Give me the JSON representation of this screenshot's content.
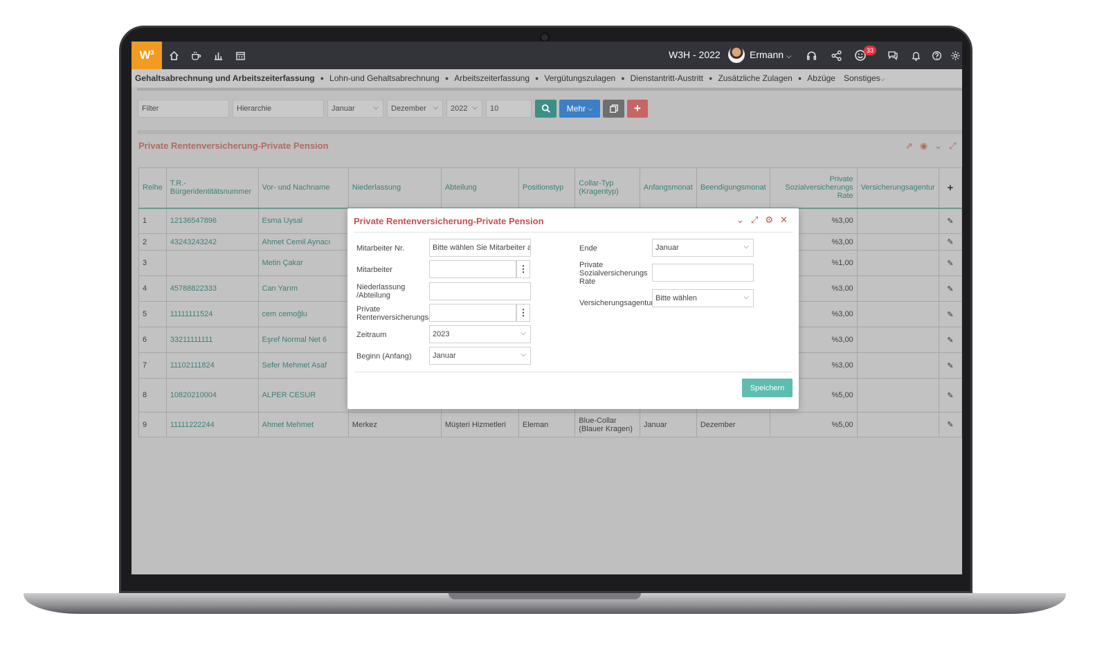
{
  "topbar": {
    "logo": "W",
    "logo_sup": "3",
    "title": "W3H - 2022",
    "user_name": "Ermann",
    "notification_count": "33"
  },
  "menu": {
    "items": [
      "Gehaltsabrechnung und Arbeitszeiterfassung",
      "Lohn-und Gehaltsabrechnung",
      "Arbeitszeiterfassung",
      "Vergütungszulagen",
      "Dienstantritt-Austritt",
      "Zusätzliche Zulagen",
      "Abzüge",
      "Sonstiges"
    ]
  },
  "filters": {
    "filter_placeholder": "Filter",
    "hierarchy_placeholder": "Hierarchie",
    "start_month": "Januar",
    "end_month": "Dezember",
    "year": "2022",
    "count": "10",
    "more_label": "Mehr"
  },
  "panel": {
    "title": "Private Rentenversicherung-Private Pension"
  },
  "table": {
    "headers": [
      "Reihe",
      "T.R.-Bürgeridentitätsnummer",
      "Vor- und Nachname",
      "Niederlassung",
      "Abteilung",
      "Positionstyp",
      "Collar-Typ (Kragentyp)",
      "Anfangsmonat",
      "Beendigungsmonat",
      "Private Sozialversicherungs Rate",
      "Versicherungsagentur"
    ],
    "rows": [
      {
        "n": "1",
        "id": "12136547896",
        "name": "Esma Uysal",
        "branch": "",
        "dept": "",
        "pos": "",
        "collar": "",
        "start": "",
        "end": "",
        "rate": "%3,00",
        "agency": ""
      },
      {
        "n": "2",
        "id": "43243243242",
        "name": "Ahmet Cemil Aynacı",
        "branch": "",
        "dept": "",
        "pos": "",
        "collar": "",
        "start": "",
        "end": "",
        "rate": "%3,00",
        "agency": ""
      },
      {
        "n": "3",
        "id": "",
        "name": "Metin Çakar",
        "branch": "",
        "dept": "",
        "pos": "",
        "collar": "",
        "start": "",
        "end": "",
        "rate": "%1,00",
        "agency": ""
      },
      {
        "n": "4",
        "id": "45788822333",
        "name": "Can Yarım",
        "branch": "",
        "dept": "",
        "pos": "",
        "collar": "",
        "start": "",
        "end": "",
        "rate": "%3,00",
        "agency": ""
      },
      {
        "n": "5",
        "id": "11111111524",
        "name": "cem cemoğlu",
        "branch": "",
        "dept": "",
        "pos": "",
        "collar": "",
        "start": "",
        "end": "",
        "rate": "%3,00",
        "agency": ""
      },
      {
        "n": "6",
        "id": "33211111111",
        "name": "Eşref Normal Net 6",
        "branch": "",
        "dept": "",
        "pos": "",
        "collar": "",
        "start": "",
        "end": "",
        "rate": "%3,00",
        "agency": ""
      },
      {
        "n": "7",
        "id": "11102111824",
        "name": "Sefer Mehmet Asaf",
        "branch": "",
        "dept": "",
        "pos": "",
        "collar": "",
        "start": "",
        "end": "",
        "rate": "%3,00",
        "agency": ""
      },
      {
        "n": "8",
        "id": "10820210004",
        "name": "ALPER CESUR",
        "branch": "",
        "dept": "",
        "pos": "",
        "collar": "",
        "start": "",
        "end": "",
        "rate": "%5,00",
        "agency": ""
      },
      {
        "n": "9",
        "id": "11111222244",
        "name": "Ahmet Mehmet",
        "branch": "Merkez",
        "dept": "Müşteri Hizmetleri",
        "pos": "Eleman",
        "collar": "Blue-Collar (Blauer Kragen)",
        "start": "Januar",
        "end": "Dezember",
        "rate": "%5,00",
        "agency": ""
      }
    ]
  },
  "modal": {
    "title": "Private Rentenversicherung-Private Pension",
    "labels": {
      "employee_no": "Mitarbeiter Nr.",
      "employee": "Mitarbeiter",
      "branch_dept": "Niederlassung /Abteilung",
      "private_pension": "Private Rentenversicherungsa",
      "period": "Zeitraum",
      "begin": "Beginn (Anfang)",
      "end": "Ende",
      "rate": "Private Sozialversicherungs Rate",
      "agency": "Versicherungsagentur"
    },
    "values": {
      "employee_no": "Bitte wählen Sie Mitarbeiter a",
      "period": "2023",
      "begin": "Januar",
      "end": "Januar",
      "agency": "Bitte wählen"
    },
    "save_label": "Speichern"
  },
  "colors": {
    "accent_orange": "#f29a22",
    "topbar": "#33343a",
    "teal": "#5dbdae",
    "red_title": "#c6514f",
    "blue_button": "#3d7fc4"
  }
}
